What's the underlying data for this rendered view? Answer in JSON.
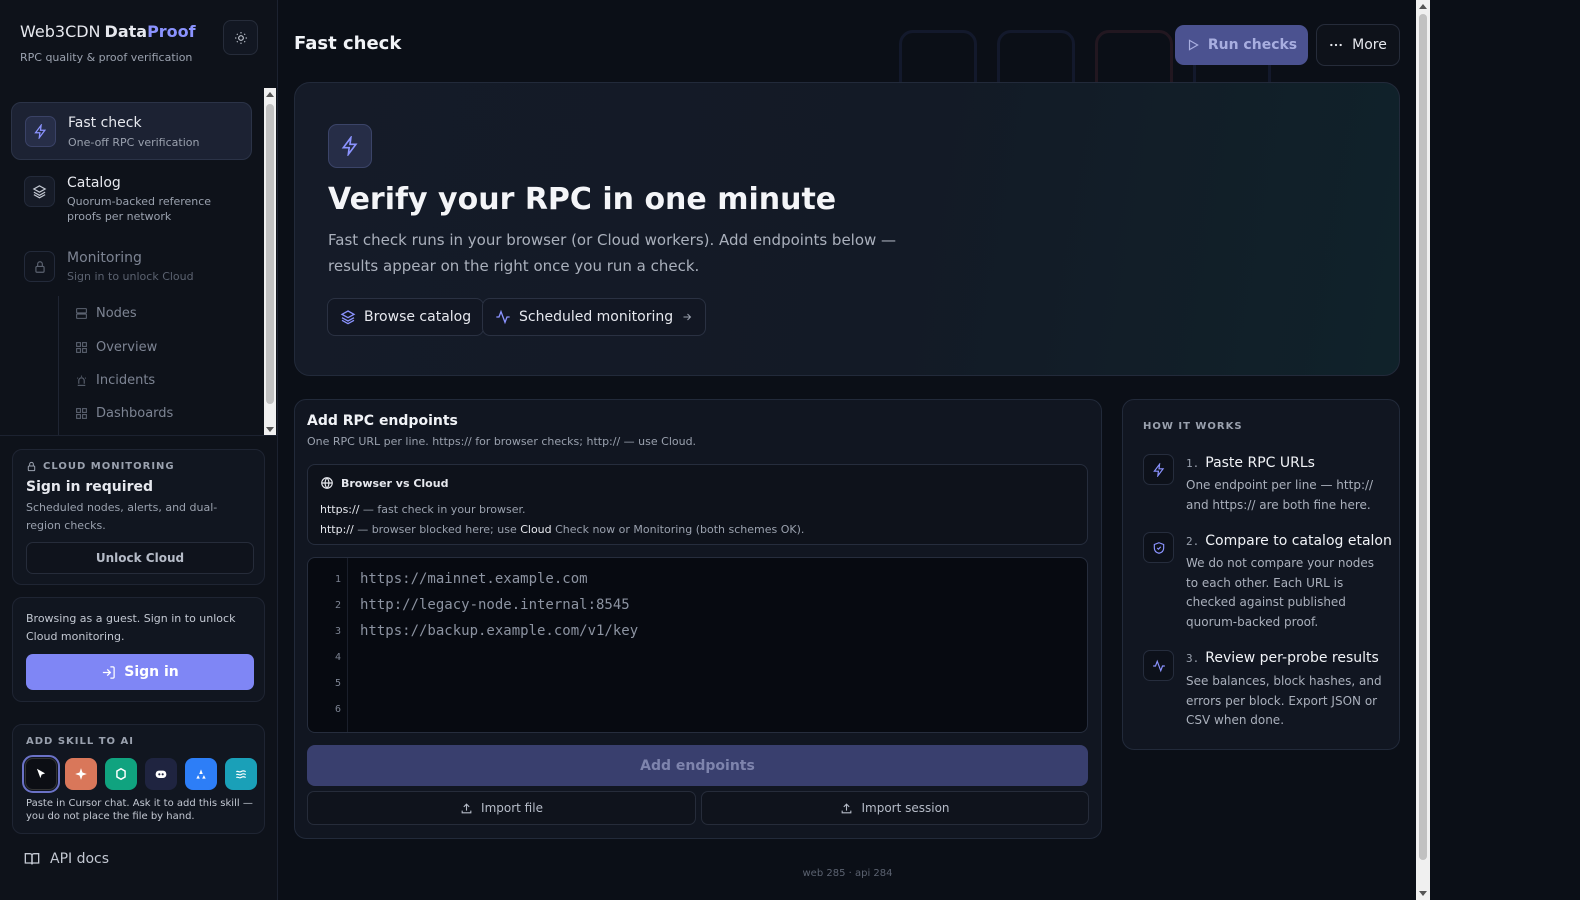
{
  "brand": {
    "part1": "Web3CDN",
    "part2": "Data",
    "part3": "Proof",
    "subtitle": "RPC quality & proof verification",
    "accent": "#8b93ff"
  },
  "sidebar": {
    "nav": [
      {
        "title": "Fast check",
        "sub": "One-off RPC verification",
        "icon": "bolt-icon",
        "active": true
      },
      {
        "title": "Catalog",
        "sub": "Quorum-backed reference proofs per network",
        "icon": "layers-icon"
      },
      {
        "title": "Monitoring",
        "sub": "Sign in to unlock Cloud",
        "icon": "lock-icon",
        "locked": true
      }
    ],
    "subitems": [
      {
        "label": "Nodes",
        "icon": "server-icon"
      },
      {
        "label": "Overview",
        "icon": "grid-icon"
      },
      {
        "label": "Incidents",
        "icon": "siren-icon"
      },
      {
        "label": "Dashboards",
        "icon": "grid-icon"
      }
    ],
    "cloud": {
      "label": "CLOUD MONITORING",
      "title": "Sign in required",
      "desc": "Scheduled nodes, alerts, and dual-region checks.",
      "button": "Unlock Cloud"
    },
    "guest": {
      "text": "Browsing as a guest. Sign in to unlock Cloud monitoring.",
      "button": "Sign in"
    },
    "skill": {
      "label": "ADD SKILL TO AI",
      "note": "Paste in Cursor chat. Ask it to add this skill — you do not place the file by hand."
    },
    "api_docs": "API docs"
  },
  "header": {
    "title": "Fast check",
    "run": "Run checks",
    "more": "More"
  },
  "hero": {
    "heading": "Verify your RPC in one minute",
    "text": "Fast check runs in your browser (or Cloud workers). Add endpoints below — results appear on the right once you run a check.",
    "btn_catalog": "Browse catalog",
    "btn_monitoring": "Scheduled monitoring"
  },
  "endpoints": {
    "title": "Add RPC endpoints",
    "sub": "One RPC URL per line. https:// for browser checks; http:// — use Cloud.",
    "bvc_title": "Browser vs Cloud",
    "bvc_l1_scheme": "https://",
    "bvc_l1_text": " — fast check in your browser.",
    "bvc_l2_scheme": "http://",
    "bvc_l2_text_a": " — browser blocked here; use ",
    "bvc_l2_cloud": "Cloud",
    "bvc_l2_text_b": " Check now or Monitoring (both schemes OK).",
    "line_numbers": [
      "1",
      "2",
      "3",
      "4",
      "5",
      "6"
    ],
    "lines": [
      "https://mainnet.example.com",
      "http://legacy-node.internal:8545",
      "https://backup.example.com/v1/key"
    ],
    "add_button": "Add endpoints",
    "import_file": "Import file",
    "import_session": "Import session"
  },
  "how": {
    "label": "HOW IT WORKS",
    "steps": [
      {
        "n": "1.",
        "title": "Paste RPC URLs",
        "desc": "One endpoint per line — http:// and https:// are both fine here."
      },
      {
        "n": "2.",
        "title": "Compare to catalog etalon",
        "desc": "We do not compare your nodes to each other. Each URL is checked against published quorum-backed proof."
      },
      {
        "n": "3.",
        "title": "Review per-probe results",
        "desc": "See balances, block hashes, and errors per block. Export JSON or CSV when done."
      }
    ]
  },
  "footer": "web 285 · api 284"
}
